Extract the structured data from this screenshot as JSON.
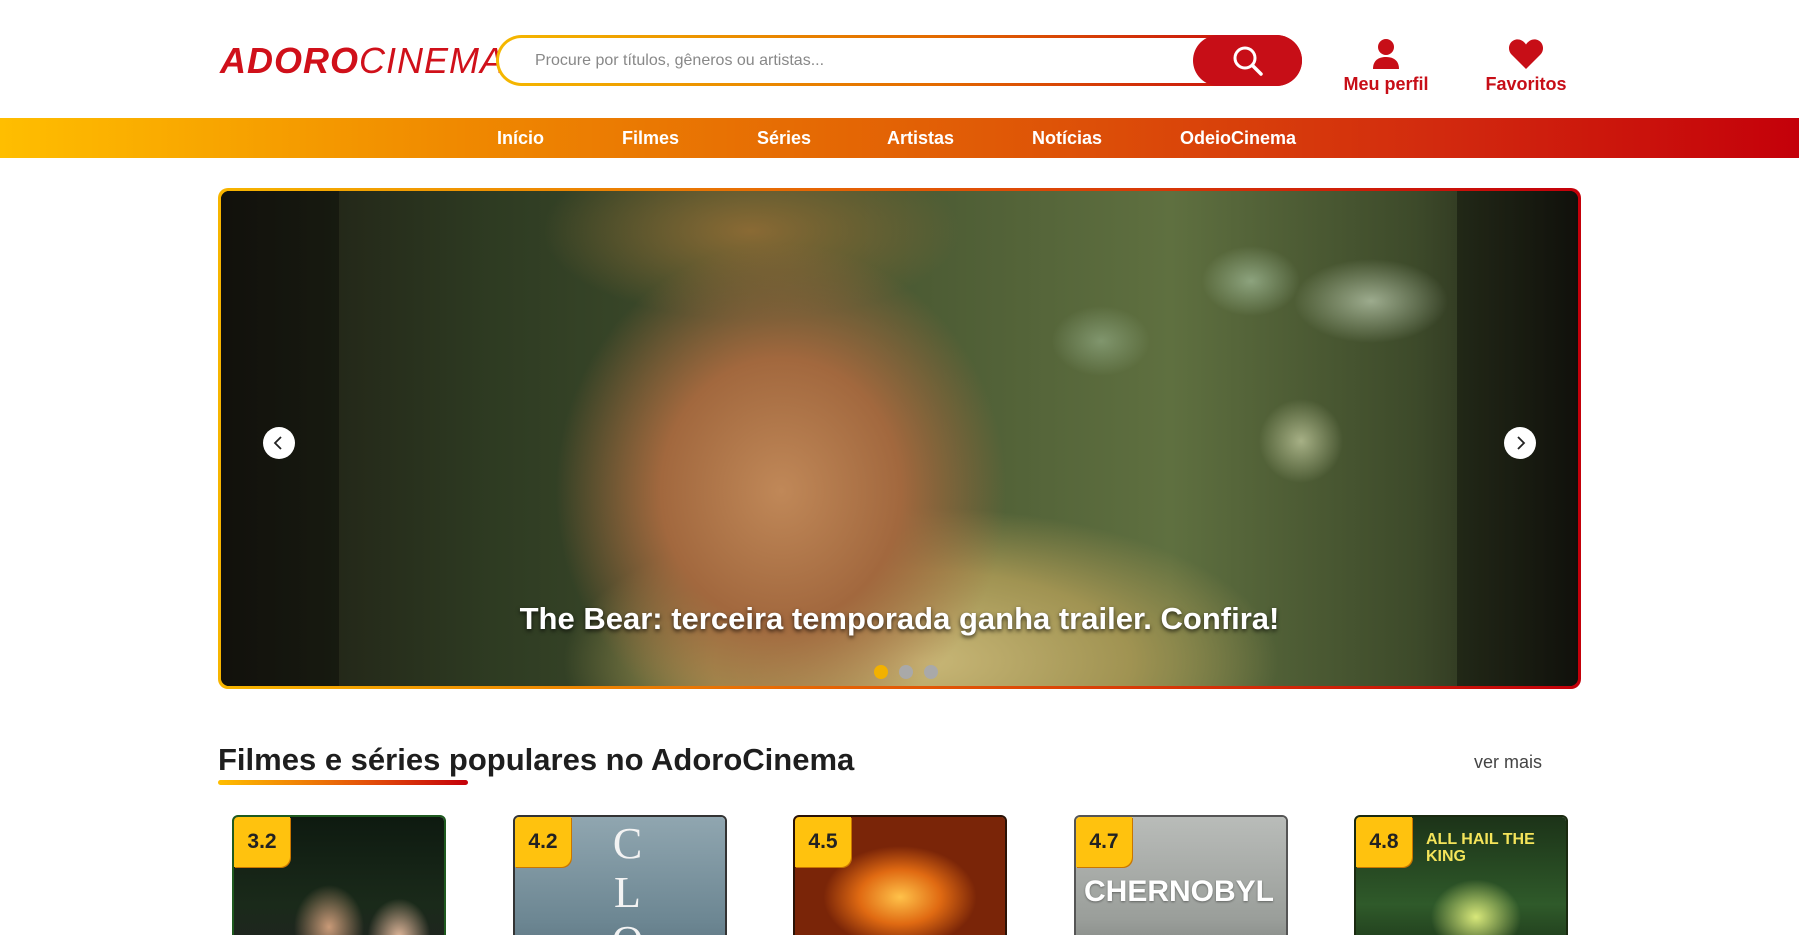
{
  "header": {
    "logo_bold": "ADORO",
    "logo_thin": "CINEMA",
    "search_placeholder": "Procure por títulos, gêneros ou artistas...",
    "profile_label": "Meu perfil",
    "favorites_label": "Favoritos"
  },
  "nav": {
    "items": [
      "Início",
      "Filmes",
      "Séries",
      "Artistas",
      "Notícias",
      "OdeioCinema"
    ]
  },
  "carousel": {
    "title": "The Bear: terceira temporada ganha trailer. Confira!",
    "active_index": 0,
    "slide_count": 3
  },
  "section": {
    "title": "Filmes e séries populares no AdoroCinema",
    "see_more": "ver mais"
  },
  "cards": [
    {
      "rating": "3.2",
      "poster_text": ""
    },
    {
      "rating": "4.2",
      "poster_text": "CLO"
    },
    {
      "rating": "4.5",
      "poster_text": ""
    },
    {
      "rating": "4.7",
      "poster_text": "CHERNOBYL"
    },
    {
      "rating": "4.8",
      "poster_text": "ALL HAIL THE KING"
    }
  ],
  "colors": {
    "brand_red": "#c70e17",
    "accent_yellow": "#ffc20e",
    "nav_gradient_start": "#ffbe00",
    "nav_gradient_end": "#c4000a"
  },
  "icons": {
    "search": "search-icon",
    "profile": "user-icon",
    "favorites": "heart-icon",
    "prev": "chevron-left-icon",
    "next": "chevron-right-icon"
  }
}
